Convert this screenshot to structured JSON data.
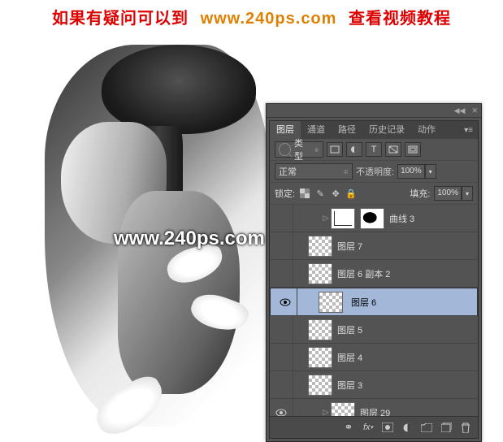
{
  "banner": {
    "text1": "如果有疑问可以到",
    "url": "www.240ps.com",
    "text2": "查看视频教程"
  },
  "watermark": "www.240ps.com",
  "panel": {
    "tabs": [
      "图层",
      "通道",
      "路径",
      "历史记录",
      "动作"
    ],
    "activeTab": 0,
    "filterLabel": "类型",
    "blendMode": "正常",
    "opacityLabel": "不透明度:",
    "opacityValue": "100%",
    "lockLabel": "锁定:",
    "fillLabel": "填充:",
    "fillValue": "100%",
    "layers": [
      {
        "visible": false,
        "indent": "deep",
        "thumb": "curves",
        "mask": true,
        "name": "曲线 3",
        "tri": true
      },
      {
        "visible": false,
        "indent": "",
        "thumb": "checker",
        "name": "图层 7"
      },
      {
        "visible": false,
        "indent": "",
        "thumb": "checker",
        "name": "图层 6 副本 2"
      },
      {
        "visible": true,
        "indent": "",
        "thumb": "checker",
        "name": "图层 6",
        "selected": true
      },
      {
        "visible": false,
        "indent": "",
        "thumb": "checker",
        "name": "图层 5"
      },
      {
        "visible": false,
        "indent": "",
        "thumb": "checker",
        "name": "图层 4"
      },
      {
        "visible": false,
        "indent": "",
        "thumb": "checker",
        "name": "图层 3"
      },
      {
        "visible": true,
        "indent": "deep",
        "thumb": "checker",
        "name": "图层 29",
        "tri": true
      }
    ]
  }
}
